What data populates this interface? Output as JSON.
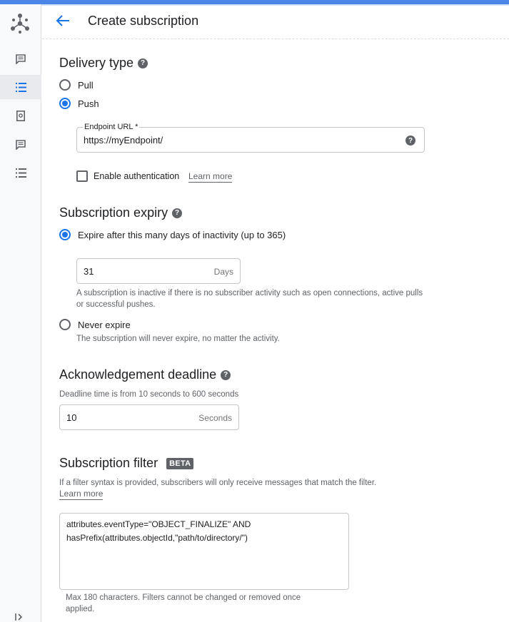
{
  "header": {
    "title": "Create subscription"
  },
  "rail": {
    "items": [
      {
        "icon": "message-icon"
      },
      {
        "icon": "list-icon",
        "active": true
      },
      {
        "icon": "snapshot-icon"
      },
      {
        "icon": "message-icon"
      },
      {
        "icon": "list-icon"
      }
    ]
  },
  "delivery": {
    "heading": "Delivery type",
    "options": [
      "Pull",
      "Push"
    ],
    "selected": "Push",
    "endpoint": {
      "label": "Endpoint URL *",
      "value": "https://myEndpoint/"
    },
    "auth": {
      "label": "Enable authentication",
      "learn_more": "Learn more",
      "checked": false
    }
  },
  "expiry": {
    "heading": "Subscription expiry",
    "option_expire": "Expire after this many days of inactivity (up to 365)",
    "days_value": "31",
    "days_suffix": "Days",
    "days_help": "A subscription is inactive if there is no subscriber activity such as open connections, active pulls or successful pushes.",
    "option_never": "Never expire",
    "never_help": "The subscription will never expire, no matter the activity."
  },
  "ack": {
    "heading": "Acknowledgement deadline",
    "help": "Deadline time is from 10 seconds to 600 seconds",
    "value": "10",
    "suffix": "Seconds"
  },
  "filter": {
    "heading": "Subscription filter",
    "badge": "BETA",
    "help": "If a filter syntax is provided, subscribers will only receive messages that match the filter.",
    "learn_more": "Learn more",
    "line1": "attributes.eventType=\"OBJECT_FINALIZE\" AND",
    "line2": "hasPrefix(attributes.objectId,\"path/to/directory/\")",
    "footer": "Max 180 characters. Filters cannot be changed or removed once applied."
  },
  "colors": {
    "accent": "#1a73e8",
    "topbar": "#4b86e6"
  }
}
